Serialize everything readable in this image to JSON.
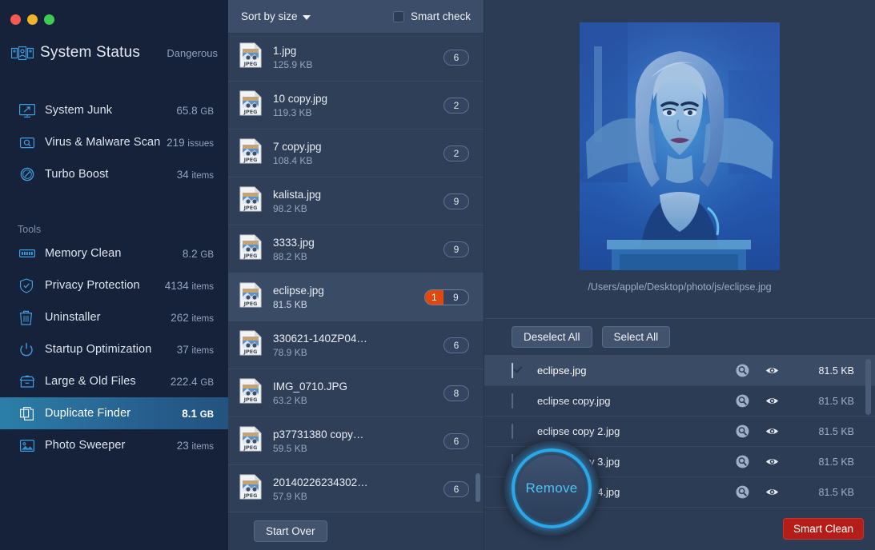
{
  "window": {
    "traffic_lights": [
      "close",
      "minimize",
      "zoom"
    ]
  },
  "sidebar": {
    "status": {
      "title": "System Status",
      "badge": "Dangerous",
      "icon": "system-status-icon"
    },
    "main_items": [
      {
        "label": "System Junk",
        "value": "65.8",
        "unit": "GB",
        "icon": "monitor-icon"
      },
      {
        "label": "Virus & Malware Scan",
        "value": "219",
        "unit": "issues",
        "icon": "scan-icon"
      },
      {
        "label": "Turbo Boost",
        "value": "34",
        "unit": "items",
        "icon": "gauge-icon"
      }
    ],
    "tools_label": "Tools",
    "tools_items": [
      {
        "label": "Memory Clean",
        "value": "8.2",
        "unit": "GB",
        "icon": "memory-icon",
        "selected": false
      },
      {
        "label": "Privacy Protection",
        "value": "4134",
        "unit": "items",
        "icon": "shield-icon",
        "selected": false
      },
      {
        "label": "Uninstaller",
        "value": "262",
        "unit": "items",
        "icon": "trash-icon",
        "selected": false
      },
      {
        "label": "Startup Optimization",
        "value": "37",
        "unit": "items",
        "icon": "power-icon",
        "selected": false
      },
      {
        "label": "Large & Old Files",
        "value": "222.4",
        "unit": "GB",
        "icon": "archive-icon",
        "selected": false
      },
      {
        "label": "Duplicate Finder",
        "value": "8.1",
        "unit": "GB",
        "icon": "duplicate-icon",
        "selected": true
      },
      {
        "label": "Photo Sweeper",
        "value": "23",
        "unit": "items",
        "icon": "photo-icon",
        "selected": false
      }
    ]
  },
  "filelist": {
    "sort_label": "Sort by size",
    "smart_check_label": "Smart check",
    "smart_check_checked": false,
    "start_over_label": "Start Over",
    "rows": [
      {
        "name": "1.jpg",
        "size": "125.9 KB",
        "count": "6",
        "selected_count": null,
        "active": false
      },
      {
        "name": "10 copy.jpg",
        "size": "119.3 KB",
        "count": "2",
        "selected_count": null,
        "active": false
      },
      {
        "name": "7 copy.jpg",
        "size": "108.4 KB",
        "count": "2",
        "selected_count": null,
        "active": false
      },
      {
        "name": "kalista.jpg",
        "size": "98.2 KB",
        "count": "9",
        "selected_count": null,
        "active": false
      },
      {
        "name": "3333.jpg",
        "size": "88.2 KB",
        "count": "9",
        "selected_count": null,
        "active": false
      },
      {
        "name": "eclipse.jpg",
        "size": "81.5 KB",
        "count": "9",
        "selected_count": "1",
        "active": true
      },
      {
        "name": "330621-140ZP04…",
        "size": "78.9 KB",
        "count": "6",
        "selected_count": null,
        "active": false
      },
      {
        "name": "IMG_0710.JPG",
        "size": "63.2 KB",
        "count": "8",
        "selected_count": null,
        "active": false
      },
      {
        "name": "p37731380 copy…",
        "size": "59.5 KB",
        "count": "6",
        "selected_count": null,
        "active": false
      },
      {
        "name": "20140226234302…",
        "size": "57.9 KB",
        "count": "6",
        "selected_count": null,
        "active": false
      }
    ]
  },
  "preview": {
    "path": "/Users/apple/Desktop/photo/js/eclipse.jpg",
    "image_alt": "photo-preview"
  },
  "duplicates": {
    "deselect_all_label": "Deselect All",
    "select_all_label": "Select All",
    "search_icon": "magnifier-icon",
    "reveal_icon": "eye-icon",
    "rows": [
      {
        "name": "eclipse.jpg",
        "size": "81.5 KB",
        "checked": true
      },
      {
        "name": "eclipse copy.jpg",
        "size": "81.5 KB",
        "checked": false
      },
      {
        "name": "eclipse copy 2.jpg",
        "size": "81.5 KB",
        "checked": false
      },
      {
        "name": "eclipse copy 3.jpg",
        "size": "81.5 KB",
        "checked": false
      },
      {
        "name": "eclipse copy 4.jpg",
        "size": "81.5 KB",
        "checked": false
      }
    ]
  },
  "actions": {
    "remove_label": "Remove",
    "smart_clean_label": "Smart Clean"
  },
  "colors": {
    "sidebar_bg": "#16213a",
    "panel_bg": "#2c3c54",
    "accent_blue": "#2aa8e8",
    "selected_nav": "#2a7fa8",
    "badge_orange": "#e0490e",
    "smart_clean_red": "#b51e18"
  }
}
